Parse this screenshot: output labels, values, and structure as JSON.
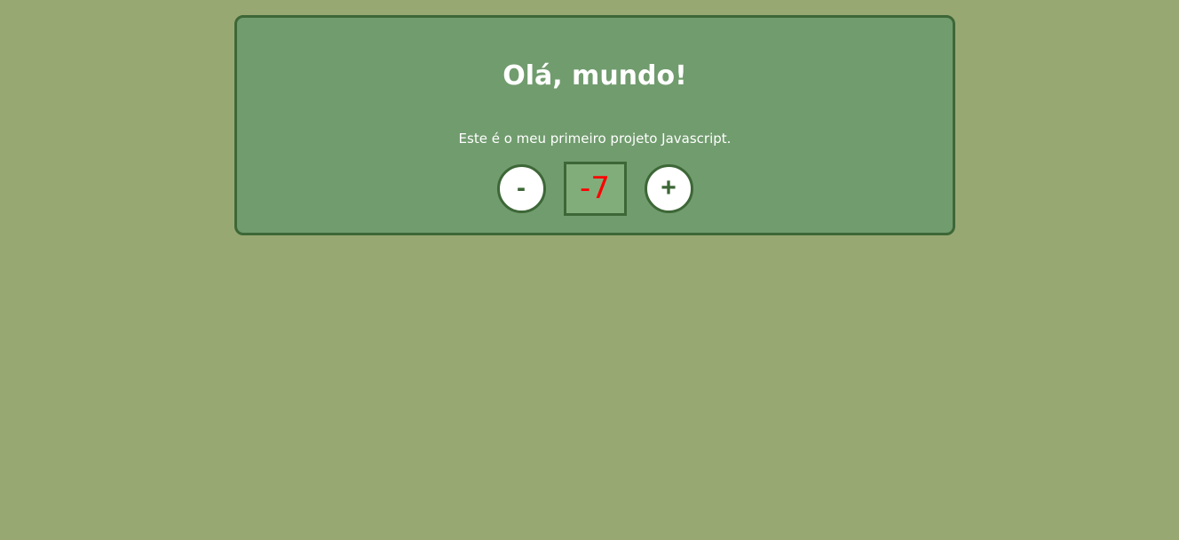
{
  "card": {
    "title": "Olá, mundo!",
    "subtitle": "Este é o meu primeiro projeto Javascript."
  },
  "counter": {
    "decrement_label": "-",
    "value": "-7",
    "increment_label": "+"
  },
  "colors": {
    "page_background": "#98a872",
    "card_background": "#719c6e",
    "border": "#3d6737",
    "value_box_background": "#81ad7a",
    "negative_value": "#ff0000"
  }
}
